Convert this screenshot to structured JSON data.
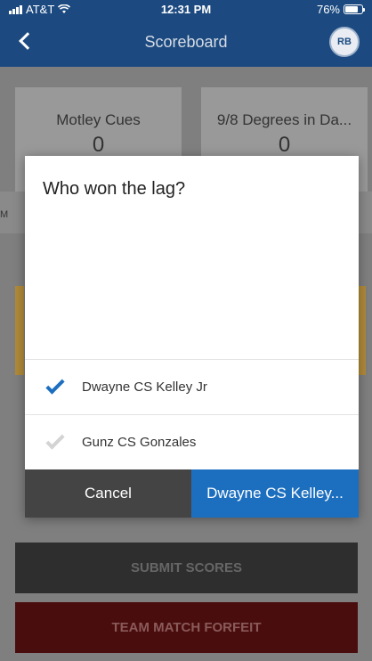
{
  "status_bar": {
    "carrier": "AT&T",
    "time": "12:31 PM",
    "battery": "76%",
    "battery_level": 0.76,
    "icons": [
      "signal-icon",
      "wifi-icon",
      "battery-icon"
    ]
  },
  "nav": {
    "title": "Scoreboard",
    "avatar_initials": "RB"
  },
  "teams": [
    {
      "name": "Motley Cues",
      "score": "0"
    },
    {
      "name": "9/8 Degrees in Da...",
      "score": "0"
    }
  ],
  "background": {
    "band_label": "M",
    "submit_label": "SUBMIT SCORES",
    "forfeit_label": "TEAM MATCH FORFEIT"
  },
  "dialog": {
    "title": "Who won the lag?",
    "options": [
      {
        "label": "Dwayne CS Kelley Jr",
        "selected": true
      },
      {
        "label": "Gunz CS Gonzales",
        "selected": false
      }
    ],
    "cancel_label": "Cancel",
    "confirm_label": "Dwayne CS Kelley..."
  },
  "colors": {
    "nav_blue": "#1c4a80",
    "accent_blue": "#1c6fbf",
    "forfeit_red": "#4a0d0d"
  }
}
